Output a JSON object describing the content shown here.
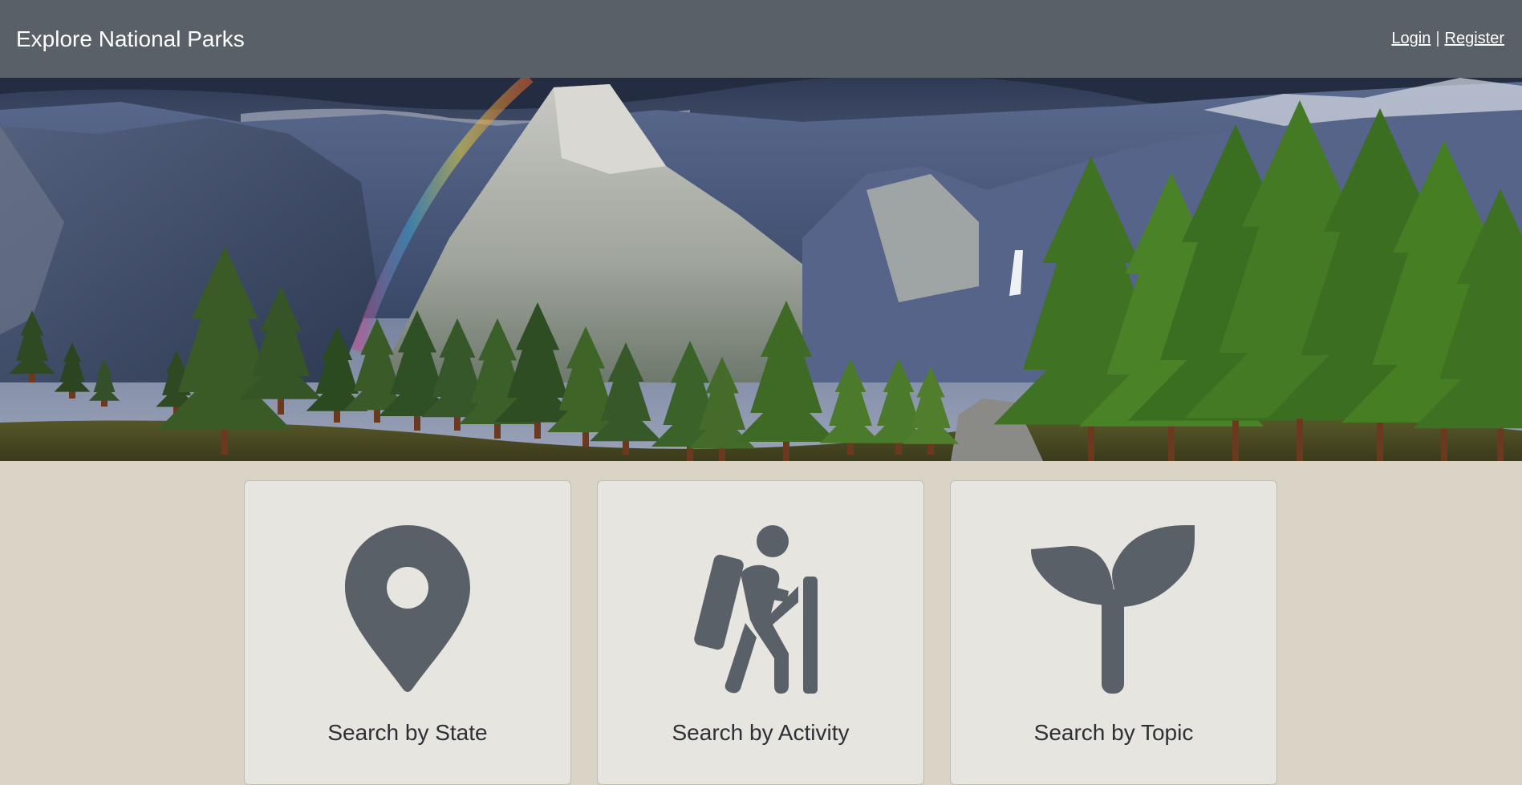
{
  "navbar": {
    "brand": "Explore National Parks",
    "login": "Login",
    "separator": "|",
    "register": "Register"
  },
  "hero": {
    "image_alt": "Yosemite valley with Half Dome, rainbow and pine trees"
  },
  "cards": [
    {
      "label": "Search by State",
      "icon": "map-pin-icon"
    },
    {
      "label": "Search by Activity",
      "icon": "hiker-icon"
    },
    {
      "label": "Search by Topic",
      "icon": "seedling-icon"
    }
  ],
  "colors": {
    "navbar": "#5a6068",
    "page_background": "#d9d4c5",
    "card_background": "#e6e5e0",
    "icon": "#5a6068"
  }
}
